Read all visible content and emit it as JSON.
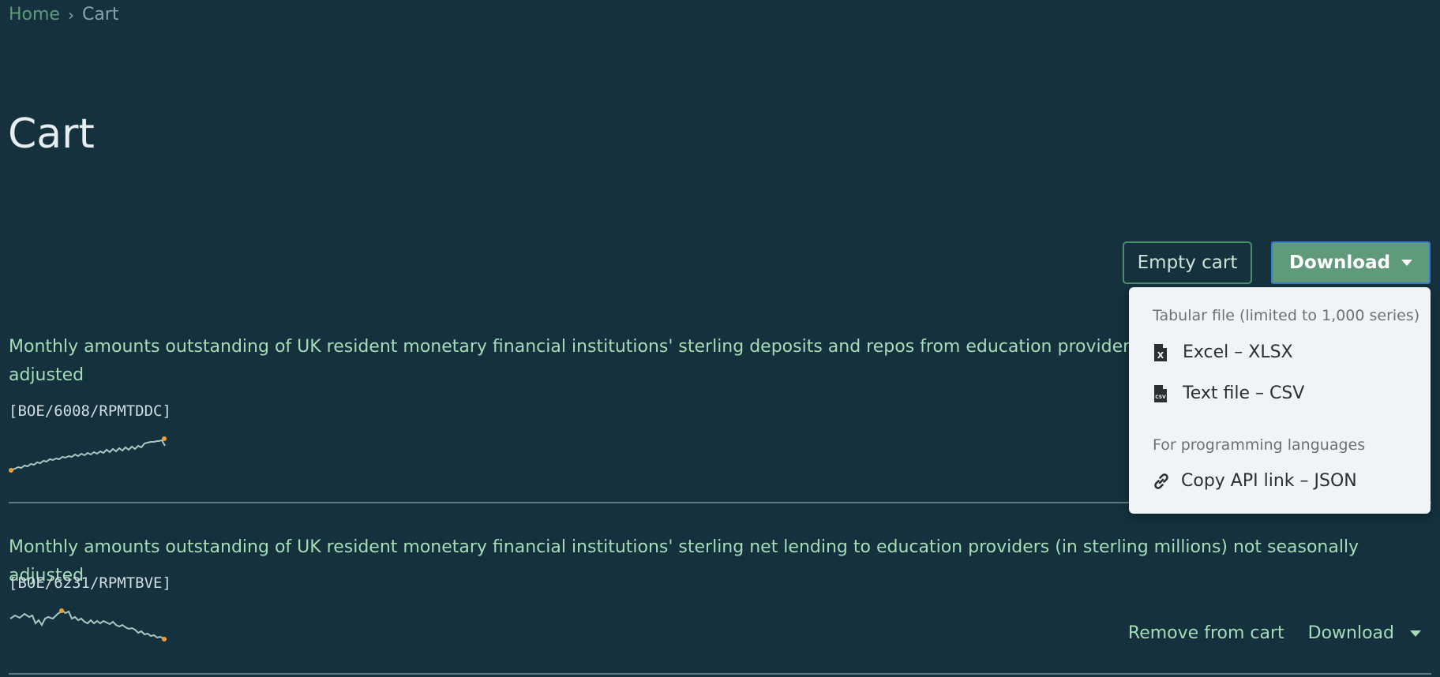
{
  "breadcrumb": {
    "home": "Home",
    "separator": "›",
    "current": "Cart"
  },
  "page_title": "Cart",
  "toolbar": {
    "empty_cart": "Empty cart",
    "download": "Download"
  },
  "download_menu": {
    "section1_header": "Tabular file (limited to 1,000 series)",
    "excel": "Excel – XLSX",
    "csv": "Text file – CSV",
    "section2_header": "For programming languages",
    "api": "Copy API link – JSON"
  },
  "items": [
    {
      "title_line1": "Monthly amounts outstanding of UK resident monetary financial institutions' sterling deposits and repos from education providers (in s",
      "title_line2": "adjusted",
      "code": "[BOE/6008/RPMTDDC]"
    },
    {
      "title": "Monthly amounts outstanding of UK resident monetary financial institutions' sterling net lending to education providers (in sterling millions) not seasonally adjusted",
      "code": "[BOE/6231/RPMTBVE]",
      "remove": "Remove from cart",
      "download": "Download"
    }
  ],
  "colors": {
    "background": "#14313d",
    "accent": "#5f9a7a",
    "link": "#a6dcb7",
    "sparkline": "#a9c8c4",
    "sparkline_marker": "#f0a030"
  },
  "icons": {
    "excel": "file-excel-icon",
    "csv": "file-csv-icon",
    "api": "link-icon",
    "caret": "chevron-down-icon"
  }
}
